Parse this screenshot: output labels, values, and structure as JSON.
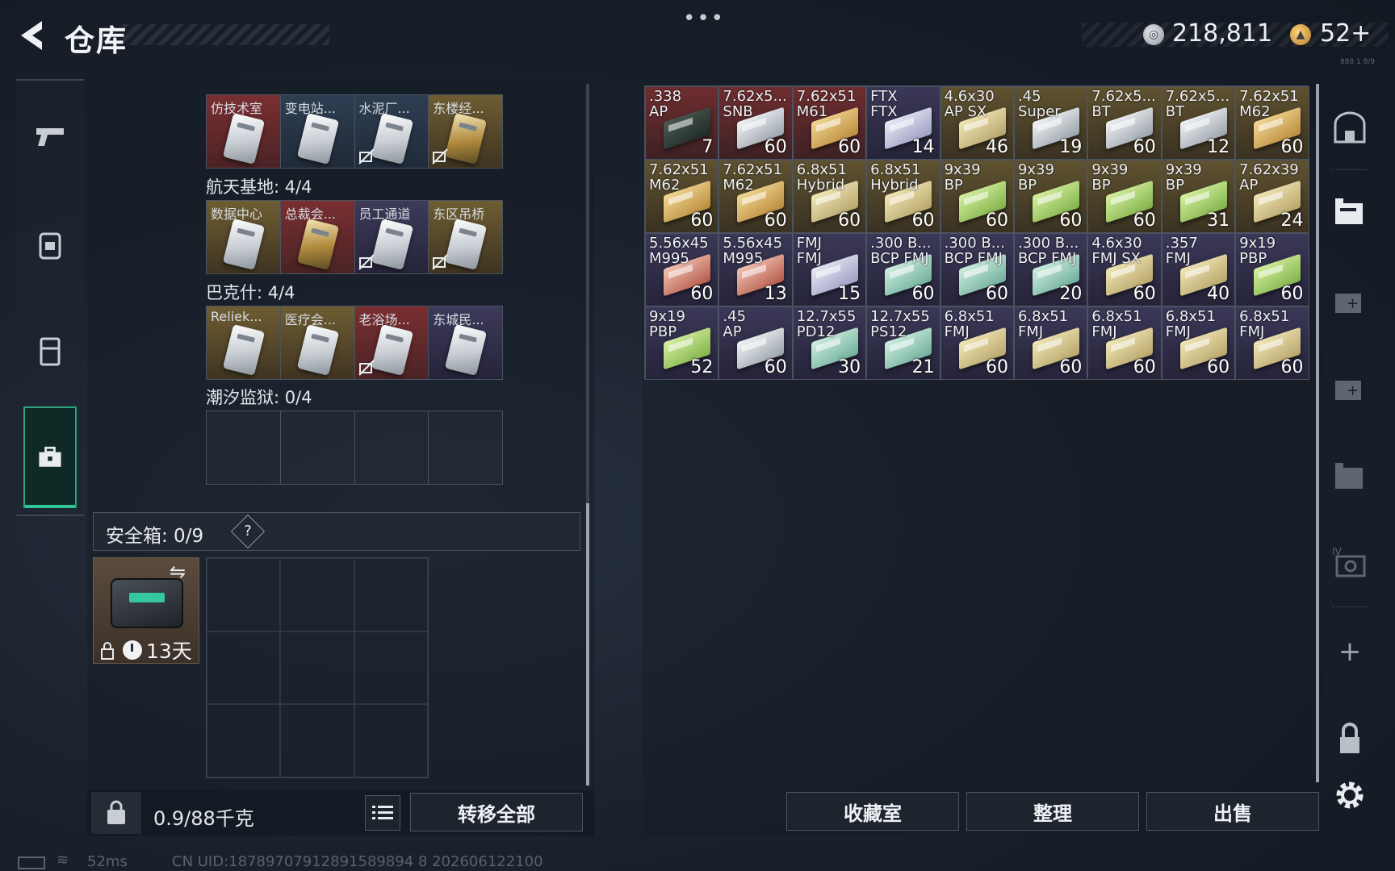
{
  "header": {
    "title": "仓库",
    "more": "•••",
    "silver_icon": "silver-coin-icon",
    "silver_amount": "218,811",
    "gold_icon": "gold-coin-icon",
    "gold_amount": "52+",
    "tiny_id": "888 1 8/9"
  },
  "left_rail": {
    "items": [
      {
        "icon": "pistol-icon"
      },
      {
        "icon": "backpack-icon"
      },
      {
        "icon": "vest-icon"
      },
      {
        "icon": "toolbox-icon",
        "active": true
      }
    ]
  },
  "keys": {
    "row1": [
      {
        "label": "仿技术室",
        "rarity": "red",
        "no_transfer": false,
        "card": "silver"
      },
      {
        "label": "变电站...",
        "rarity": "blue",
        "no_transfer": false,
        "card": "silver"
      },
      {
        "label": "水泥厂...",
        "rarity": "blue",
        "no_transfer": true,
        "card": "silver"
      },
      {
        "label": "东楼经...",
        "rarity": "gold",
        "no_transfer": true,
        "card": "gold"
      }
    ],
    "section1": "航天基地: 4/4",
    "row2": [
      {
        "label": "数据中心",
        "rarity": "gold",
        "no_transfer": false,
        "card": "silver"
      },
      {
        "label": "总裁会...",
        "rarity": "red",
        "no_transfer": false,
        "card": "gold"
      },
      {
        "label": "员工通道",
        "rarity": "purple",
        "no_transfer": true,
        "card": "silver"
      },
      {
        "label": "东区吊桥",
        "rarity": "gold",
        "no_transfer": true,
        "card": "silver"
      }
    ],
    "section2": "巴克什: 4/4",
    "row3": [
      {
        "label": "Reliek...",
        "rarity": "gold",
        "no_transfer": false,
        "card": "silver"
      },
      {
        "label": "医疗会...",
        "rarity": "gold",
        "no_transfer": false,
        "card": "silver"
      },
      {
        "label": "老浴场...",
        "rarity": "red",
        "no_transfer": true,
        "card": "silver"
      },
      {
        "label": "东城民...",
        "rarity": "purple",
        "no_transfer": false,
        "card": "silver"
      }
    ],
    "section3": "潮汐监狱: 0/4"
  },
  "safebox": {
    "label": "安全箱: 0/9",
    "help": "?",
    "swap_icon": "swap-icon",
    "duration": "13天"
  },
  "weight": {
    "text": "0.9/88千克",
    "list_icon": "list-icon",
    "transfer_all": "转移全部"
  },
  "status": {
    "ping": "52ms",
    "uid": "CN UID:18789707912891589894 8 202606122100"
  },
  "stash": {
    "items": [
      {
        "name": ".338\nAP",
        "qty": "7",
        "rarity": "red",
        "box": "dark"
      },
      {
        "name": "7.62x5...\nSNB",
        "qty": "60",
        "rarity": "red",
        "box": "silver"
      },
      {
        "name": "7.62x51\nM61",
        "qty": "60",
        "rarity": "red",
        "box": "gold"
      },
      {
        "name": "FTX\nFTX",
        "qty": "14",
        "rarity": "purple",
        "box": "lilac"
      },
      {
        "name": "4.6x30\nAP SX",
        "qty": "46",
        "rarity": "gold",
        "box": "khaki"
      },
      {
        "name": ".45\nSuper",
        "qty": "19",
        "rarity": "gold",
        "box": "silver"
      },
      {
        "name": "7.62x5...\nBT",
        "qty": "60",
        "rarity": "gold",
        "box": "silver"
      },
      {
        "name": "7.62x5...\nBT",
        "qty": "12",
        "rarity": "gold",
        "box": "silver"
      },
      {
        "name": "7.62x51\nM62",
        "qty": "60",
        "rarity": "gold",
        "box": "gold"
      },
      {
        "name": "7.62x51\nM62",
        "qty": "60",
        "rarity": "gold",
        "box": "gold"
      },
      {
        "name": "7.62x51\nM62",
        "qty": "60",
        "rarity": "gold",
        "box": "gold"
      },
      {
        "name": "6.8x51\nHybrid",
        "qty": "60",
        "rarity": "gold",
        "box": "khaki"
      },
      {
        "name": "6.8x51\nHybrid",
        "qty": "60",
        "rarity": "gold",
        "box": "khaki"
      },
      {
        "name": "9x39\nBP",
        "qty": "60",
        "rarity": "gold",
        "box": "green"
      },
      {
        "name": "9x39\nBP",
        "qty": "60",
        "rarity": "gold",
        "box": "green"
      },
      {
        "name": "9x39\nBP",
        "qty": "60",
        "rarity": "gold",
        "box": "green"
      },
      {
        "name": "9x39\nBP",
        "qty": "31",
        "rarity": "gold",
        "box": "green"
      },
      {
        "name": "7.62x39\nAP",
        "qty": "24",
        "rarity": "gold",
        "box": "khaki"
      },
      {
        "name": "5.56x45\nM995",
        "qty": "60",
        "rarity": "purple",
        "box": "red"
      },
      {
        "name": "5.56x45\nM995",
        "qty": "13",
        "rarity": "purple",
        "box": "red"
      },
      {
        "name": "FMJ\nFMJ",
        "qty": "15",
        "rarity": "purple",
        "box": "lilac"
      },
      {
        "name": ".300 B...\nBCP FMJ",
        "qty": "60",
        "rarity": "purple",
        "box": "teal"
      },
      {
        "name": ".300 B...\nBCP FMJ",
        "qty": "60",
        "rarity": "purple",
        "box": "teal"
      },
      {
        "name": ".300 B...\nBCP FMJ",
        "qty": "20",
        "rarity": "purple",
        "box": "teal"
      },
      {
        "name": "4.6x30\nFMJ SX",
        "qty": "60",
        "rarity": "purple",
        "box": "khaki"
      },
      {
        "name": ".357\nFMJ",
        "qty": "40",
        "rarity": "purple",
        "box": "khaki"
      },
      {
        "name": "9x19\nPBP",
        "qty": "60",
        "rarity": "purple",
        "box": "green"
      },
      {
        "name": "9x19\nPBP",
        "qty": "52",
        "rarity": "purple",
        "box": "green"
      },
      {
        "name": ".45\nAP",
        "qty": "60",
        "rarity": "purple",
        "box": "silver"
      },
      {
        "name": "12.7x55\nPD12",
        "qty": "30",
        "rarity": "purple",
        "box": "teal"
      },
      {
        "name": "12.7x55\nPS12",
        "qty": "21",
        "rarity": "purple",
        "box": "teal"
      },
      {
        "name": "6.8x51\nFMJ",
        "qty": "60",
        "rarity": "purple",
        "box": "khaki"
      },
      {
        "name": "6.8x51\nFMJ",
        "qty": "60",
        "rarity": "purple",
        "box": "khaki"
      },
      {
        "name": "6.8x51\nFMJ",
        "qty": "60",
        "rarity": "purple",
        "box": "khaki"
      },
      {
        "name": "6.8x51\nFMJ",
        "qty": "60",
        "rarity": "purple",
        "box": "khaki"
      },
      {
        "name": "6.8x51\nFMJ",
        "qty": "60",
        "rarity": "purple",
        "box": "khaki"
      }
    ]
  },
  "buttons": {
    "collection": "收藏室",
    "sort": "整理",
    "sell": "出售"
  },
  "right_rail": {
    "plus": "+",
    "icons": [
      "storage-room-icon",
      "warehouse-icon",
      "expand-storage-icon",
      "expand-storage-2-icon",
      "warehouse-3-icon",
      "warehouse-level-icon",
      "plus-icon",
      "lock-icon",
      "settings-icon"
    ]
  },
  "colors": {
    "accent_green": "#2fc596",
    "rarity_red": "#6f2d2f",
    "rarity_gold": "#5f5230",
    "rarity_purple": "#3b3858",
    "rarity_blue": "#2c3d52"
  }
}
